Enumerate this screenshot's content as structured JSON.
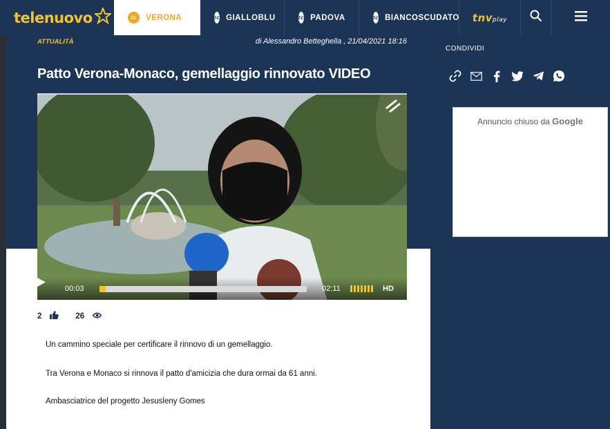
{
  "nav": {
    "logo_text": "telenuovo",
    "items": [
      {
        "label": "VERONA",
        "badge": "tc"
      },
      {
        "label": "GIALLOBLU",
        "badge": "tc"
      },
      {
        "label": "PADOVA",
        "badge": "tc"
      },
      {
        "label": "BIANCOSCUDATO",
        "badge": "tc"
      }
    ],
    "tnv_main": "tnv",
    "tnv_sub": "play"
  },
  "article": {
    "category": "ATTUALITÀ",
    "byline": "di Alessandro Betteghella , 21/04/2021 18:16",
    "title": "Patto Verona-Monaco, gemellaggio rinnovato VIDEO",
    "video": {
      "current_time": "00:03",
      "total_time": "02:11",
      "progress": 0.03,
      "quality": "HD"
    },
    "likes": "2",
    "views": "26",
    "paragraphs": [
      "Un cammino speciale per certificare il rinnovo di un gemellaggio.",
      "Tra Verona e Monaco si rinnova il patto d'amicizia che dura ormai da 61 anni.",
      "Ambasciatrice del progetto Jesusleny Gomes"
    ]
  },
  "sidebar": {
    "share_title": "CONDIVIDI",
    "share_icons": [
      "link-icon",
      "mail-icon",
      "facebook-icon",
      "twitter-icon",
      "telegram-icon",
      "whatsapp-icon"
    ],
    "ad_text": "Annuncio chiuso da",
    "ad_brand": "Google"
  },
  "colors": {
    "navy": "#1c3556",
    "accent": "#f1c232",
    "active_tab": "#f1a81f"
  }
}
